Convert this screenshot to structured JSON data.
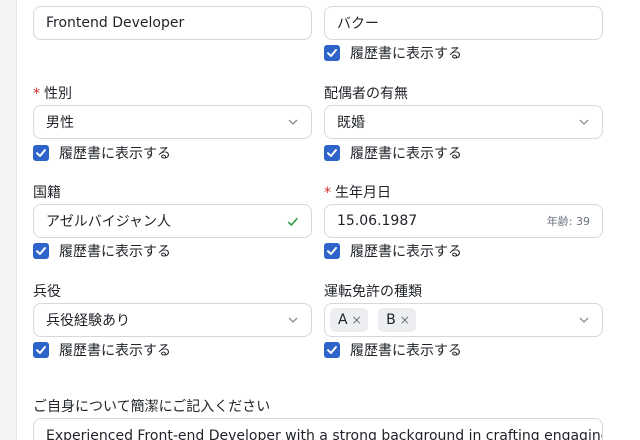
{
  "top": {
    "position_value": "Frontend Developer",
    "surname_value": "バクー",
    "surname_show_label": "履歴書に表示する"
  },
  "gender": {
    "label": "性別",
    "value": "男性",
    "show_label": "履歴書に表示する"
  },
  "marital": {
    "label": "配偶者の有無",
    "value": "既婚",
    "show_label": "履歴書に表示する"
  },
  "nationality": {
    "label": "国籍",
    "value": "アゼルバイジャン人",
    "show_label": "履歴書に表示する"
  },
  "birth": {
    "label": "生年月日",
    "value": "15.06.1987",
    "age_label": "年齢: 39",
    "show_label": "履歴書に表示する"
  },
  "military": {
    "label": "兵役",
    "value": "兵役経験あり",
    "show_label": "履歴書に表示する"
  },
  "license": {
    "label": "運転免許の種類",
    "tags": [
      "A",
      "B"
    ],
    "tag_remove": "×",
    "show_label": "履歴書に表示する"
  },
  "about": {
    "label": "ご自身について簡潔にご記入ください",
    "value": "Experienced Front-end Developer with a strong background in crafting engaging"
  },
  "required_mark": "*",
  "colors": {
    "accent": "#2e63c9",
    "required": "#d12c2c",
    "valid": "#2e9e44",
    "border": "#d5d8dc"
  }
}
